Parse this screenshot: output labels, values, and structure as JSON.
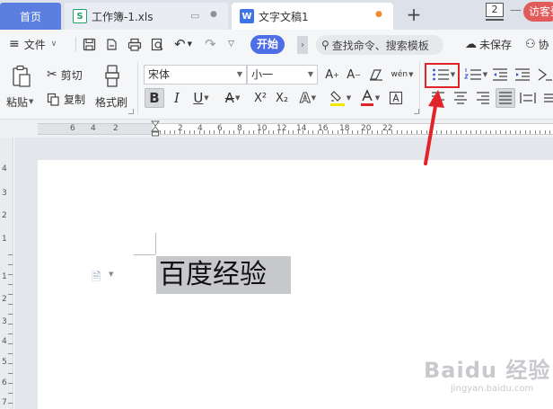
{
  "tabs": {
    "home": "首页",
    "spreadsheet": "工作簿-1.xls",
    "document": "文字文稿1",
    "spreadsheet_icon": "S",
    "document_icon": "W",
    "new_tab": "+"
  },
  "titlebar": {
    "window_count": "2",
    "visitor": "访客登"
  },
  "menu": {
    "file": "文件",
    "start": "开始",
    "search_placeholder": "查找命令、搜索模板",
    "unsaved": "未保存",
    "collab": "协"
  },
  "ribbon": {
    "paste": "粘贴",
    "cut": "剪切",
    "copy": "复制",
    "format_painter": "格式刷",
    "font_name": "宋体",
    "font_size": "小一",
    "bold": "B",
    "italic": "I",
    "underline": "U",
    "font_color_a": "A",
    "superscript": "X²",
    "subscript": "X₂",
    "phonetic": "wén",
    "highlight_color": "#f4e400",
    "font_color": "#e0242a",
    "emphasis_color": "#3056d8"
  },
  "ruler": {
    "top_labels": [
      "6",
      "4",
      "2",
      "2",
      "4",
      "6",
      "8",
      "10",
      "12",
      "14",
      "16",
      "18",
      "20",
      "22"
    ],
    "side_labels": [
      "4",
      "3",
      "2",
      "1",
      "1",
      "2",
      "3",
      "4",
      "5",
      "6",
      "7"
    ]
  },
  "document": {
    "text": "百度经验"
  },
  "watermark": {
    "main": "Bai&#x5EA6; 经验",
    "main_text": "Baidu 经验",
    "sub": "jingyan.baidu.com"
  },
  "annotation": {
    "highlight_color": "#e0242a"
  }
}
